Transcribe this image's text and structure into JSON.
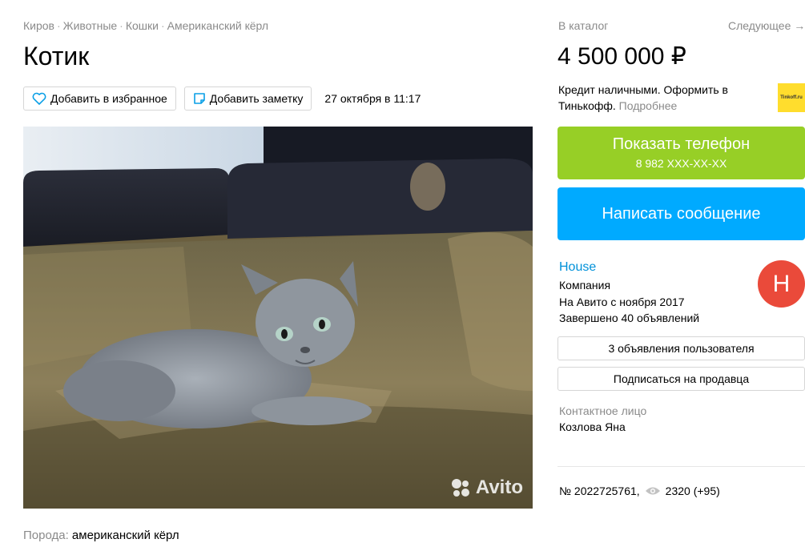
{
  "breadcrumbs": [
    "Киров",
    "Животные",
    "Кошки",
    "Американский кёрл"
  ],
  "listing": {
    "title": "Котик",
    "date": "27 октября в 11:17",
    "breed_label": "Порода:",
    "breed_value": "американский кёрл"
  },
  "actions": {
    "favorite_label": "Добавить в избранное",
    "note_label": "Добавить заметку"
  },
  "photo": {
    "watermark": "Avito"
  },
  "nav": {
    "catalog": "В каталог",
    "next": "Следующее →"
  },
  "price": "4 500 000 ₽",
  "credit": {
    "text": "Кредит наличными. Оформить в Тинькофф.",
    "more": "Подробнее",
    "logo_text": "Tinkoff.ru"
  },
  "buttons": {
    "phone_main": "Показать телефон",
    "phone_number": "8 982 XXX-XX-XX",
    "message": "Написать сообщение",
    "user_ads": "3 объявления пользователя",
    "subscribe": "Подписаться на продавца"
  },
  "seller": {
    "name": "House",
    "type": "Компания",
    "since": "На Авито с ноября 2017",
    "completed": "Завершено 40 объявлений",
    "avatar_letter": "Н"
  },
  "contact": {
    "label": "Контактное лицо",
    "name": "Козлова Яна"
  },
  "meta": {
    "id": "№ 2022725761,",
    "views": "2320 (+95)"
  },
  "colors": {
    "phone_button": "#97cf26",
    "message_button": "#00aaff",
    "seller_link": "#0091d9",
    "avatar": "#ea4a3a",
    "muted_text": "#8a8a8a"
  }
}
